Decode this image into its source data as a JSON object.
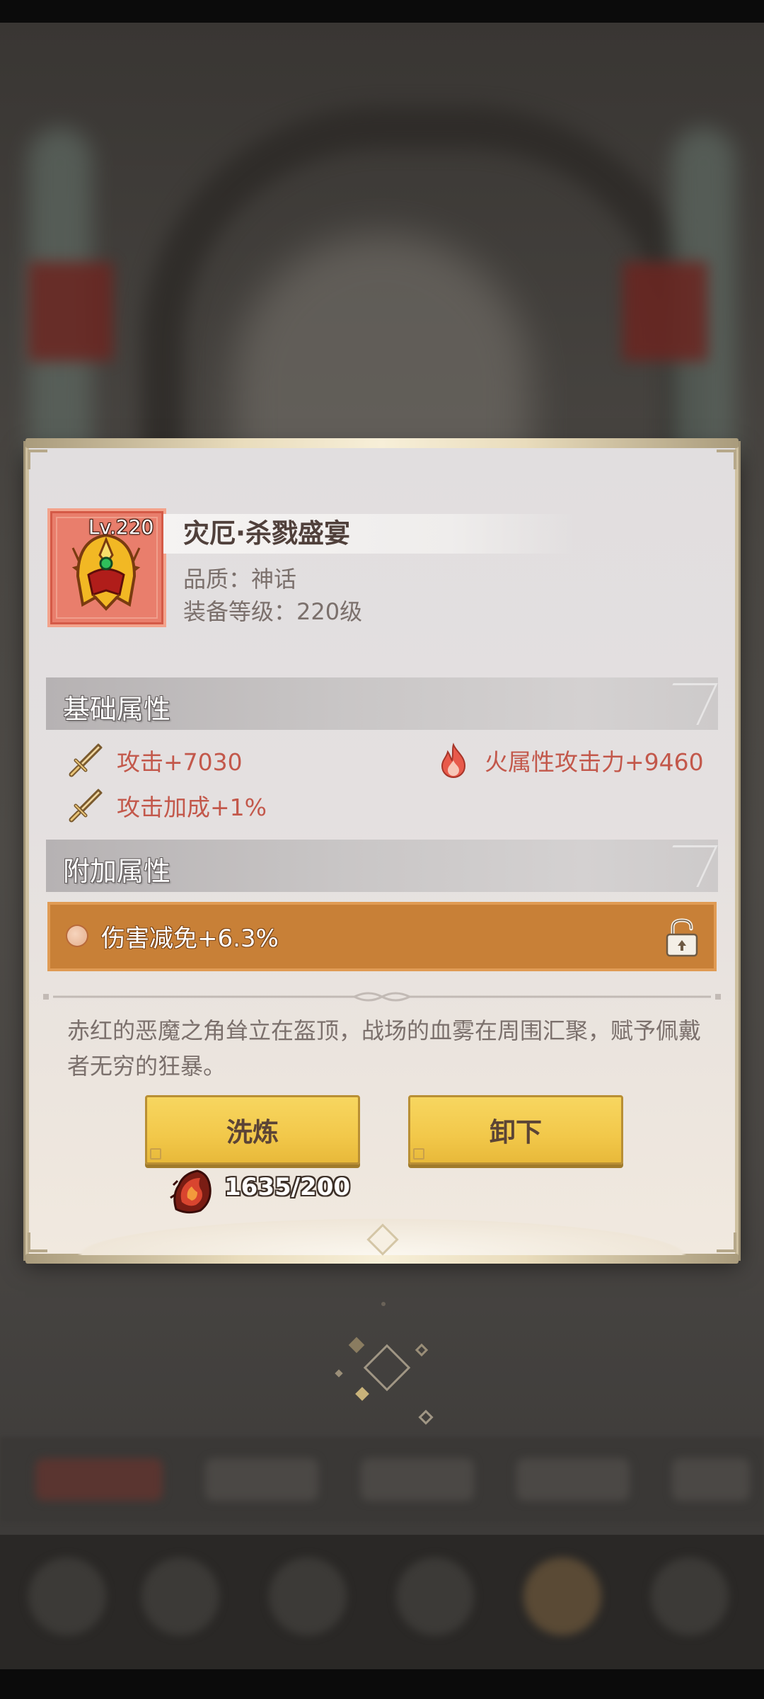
{
  "item": {
    "level_label": "Lv.220",
    "name": "灾厄·杀戮盛宴",
    "quality": "品质：神话",
    "equip_level": "装备等级：220级",
    "icon": "flame-helmet-icon"
  },
  "basic_section": {
    "title": "基础属性",
    "attrs": [
      {
        "icon": "sword-icon",
        "text": "攻击+7030"
      },
      {
        "icon": "fire-icon",
        "text": "火属性攻击力+9460"
      },
      {
        "icon": "sword-icon",
        "text": "攻击加成+1%"
      }
    ]
  },
  "extra_section": {
    "title": "附加属性",
    "attr": "伤害减免+6.3%",
    "lock_icon": "unlock-icon"
  },
  "description": "赤红的恶魔之角耸立在盔顶，战场的血雾在周围汇聚，赋予佩戴者无穷的狂暴。",
  "buttons": {
    "refine": "洗炼",
    "unequip": "卸下"
  },
  "cost": {
    "icon": "refine-stone-icon",
    "text": "1635/200"
  },
  "colors": {
    "attr_text": "#c3584b",
    "extra_bar": "#c88037",
    "button": "#f2c84a",
    "mythic_frame": "#e97e6c"
  }
}
